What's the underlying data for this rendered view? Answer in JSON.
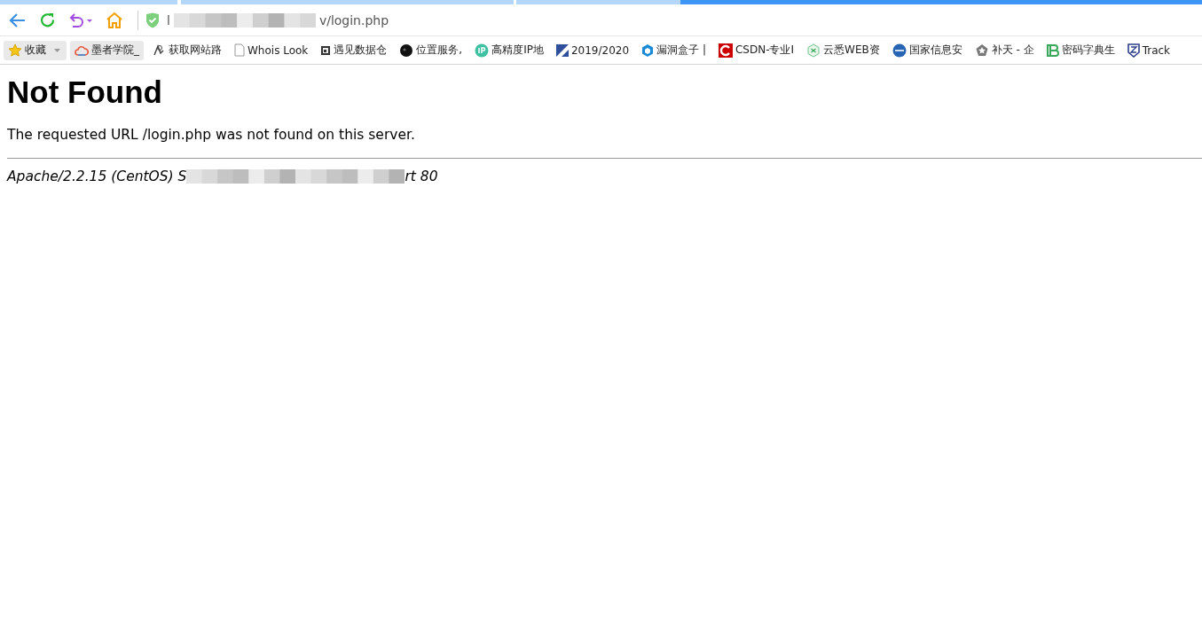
{
  "toolbar": {
    "url_start": "l",
    "url_end": "v/login.php"
  },
  "bookmarks": [
    {
      "label": "收藏",
      "highlighted": true,
      "kind": "folder"
    },
    {
      "label": "墨者学院_",
      "highlighted": true,
      "kind": "link"
    },
    {
      "label": "获取网站路",
      "highlighted": false,
      "kind": "link"
    },
    {
      "label": "Whois Look",
      "highlighted": false,
      "kind": "link"
    },
    {
      "label": "遇见数据仓",
      "highlighted": false,
      "kind": "link"
    },
    {
      "label": "位置服务,",
      "highlighted": false,
      "kind": "link"
    },
    {
      "label": "高精度IP地",
      "highlighted": false,
      "kind": "link"
    },
    {
      "label": "2019/2020",
      "highlighted": false,
      "kind": "link"
    },
    {
      "label": "漏洞盒子 |",
      "highlighted": false,
      "kind": "link"
    },
    {
      "label": "CSDN-专业I",
      "highlighted": false,
      "kind": "link"
    },
    {
      "label": "云悉WEB资",
      "highlighted": false,
      "kind": "link"
    },
    {
      "label": "国家信息安",
      "highlighted": false,
      "kind": "link"
    },
    {
      "label": "补天 - 企",
      "highlighted": false,
      "kind": "link"
    },
    {
      "label": "密码字典生",
      "highlighted": false,
      "kind": "link"
    },
    {
      "label": "Track",
      "highlighted": false,
      "kind": "link"
    }
  ],
  "page": {
    "heading": "Not Found",
    "message": "The requested URL /login.php was not found on this server.",
    "signature_start": "Apache/2.2.15 (CentOS) S",
    "signature_end": "rt 80"
  }
}
